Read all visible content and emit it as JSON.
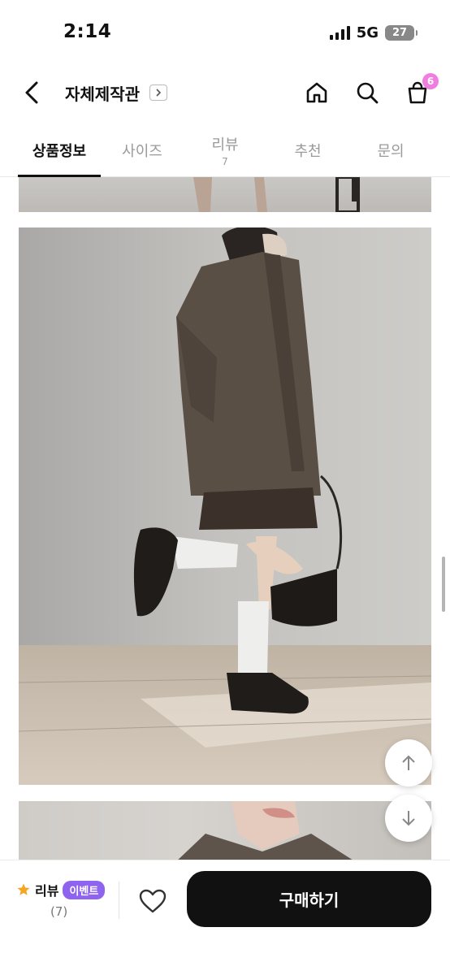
{
  "status_bar": {
    "time": "2:14",
    "network": "5G",
    "battery": "27"
  },
  "header": {
    "store_name": "자체제작관",
    "cart_count": "6"
  },
  "tabs": [
    {
      "label": "상품정보",
      "active": true
    },
    {
      "label": "사이즈"
    },
    {
      "label": "리뷰",
      "count": "7"
    },
    {
      "label": "추천"
    },
    {
      "label": "문의"
    }
  ],
  "bottom_bar": {
    "review_label": "리뷰",
    "event_badge": "이벤트",
    "review_count": "(7)",
    "buy_label": "구매하기"
  },
  "colors": {
    "badge_pink": "#f07de0",
    "event_purple": "#8e63f0",
    "star": "#f5a623",
    "buy_button": "#111111"
  }
}
